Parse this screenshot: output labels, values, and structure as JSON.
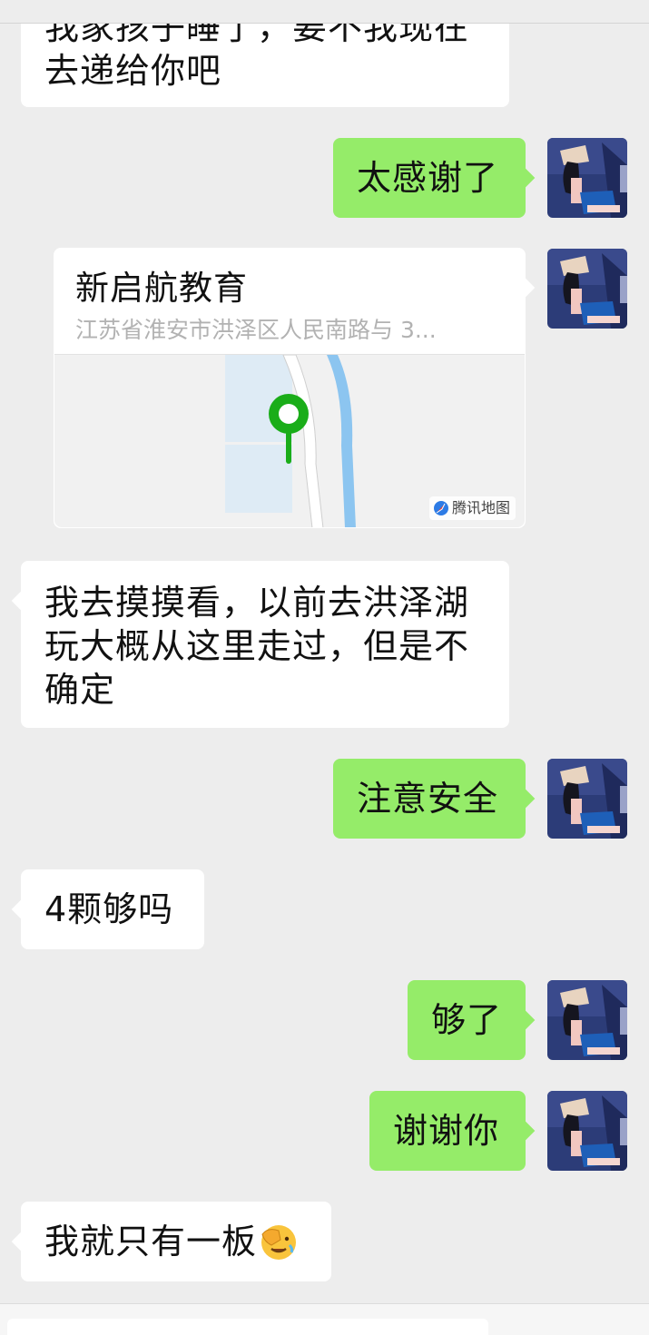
{
  "colors": {
    "background": "#ededed",
    "incoming_bubble": "#ffffff",
    "outgoing_bubble": "#95ec69",
    "map_pin": "#1aad19",
    "river": "#8cc5f0"
  },
  "messages": [
    {
      "direction": "in",
      "lines": [
        "我家孩子睡了，要不我现在",
        "去递给你吧"
      ]
    },
    {
      "direction": "out",
      "text": "太感谢了"
    },
    {
      "direction": "out",
      "type": "location",
      "title": "新启航教育",
      "address": "江苏省淮安市洪泽区人民南路与 3...",
      "map_provider": "腾讯地图"
    },
    {
      "direction": "in",
      "lines": [
        "我去摸摸看，以前去洪泽湖",
        "玩大概从这里走过，但是不",
        "确定"
      ]
    },
    {
      "direction": "out",
      "text": "注意安全"
    },
    {
      "direction": "in",
      "text": "4颗够吗"
    },
    {
      "direction": "out",
      "text": "够了"
    },
    {
      "direction": "out",
      "text": "谢谢你"
    },
    {
      "direction": "in",
      "text": "我就只有一板",
      "emoji": "facepalm-emoji"
    }
  ],
  "icons": {
    "avatar": "avatar-girl-illustration",
    "map_logo": "tencent-map-logo-icon",
    "pin": "location-pin-icon"
  }
}
